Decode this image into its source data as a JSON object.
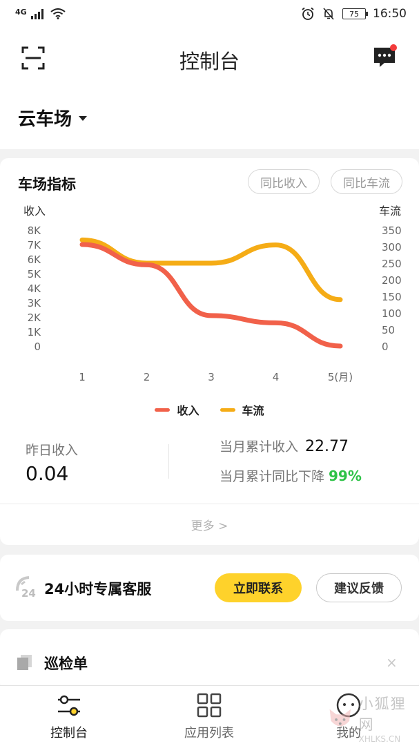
{
  "status_bar": {
    "network": "4G",
    "battery": "75",
    "time": "16:50"
  },
  "header": {
    "title": "控制台",
    "lot_name": "云车场"
  },
  "metrics": {
    "title": "车场指标",
    "btn_revenue_yoy": "同比收入",
    "btn_traffic_yoy": "同比车流",
    "yesterday_label": "昨日收入",
    "yesterday_value": "0.04",
    "month_label": "当月累计收入",
    "month_value": "22.77",
    "yoy_label": "当月累计同比下降",
    "yoy_value": "99%",
    "more": "更多 >"
  },
  "chart_data": {
    "type": "line",
    "x": [
      "1",
      "2",
      "3",
      "4",
      "5(月)"
    ],
    "left_axis": {
      "label": "收入",
      "ticks": [
        "0",
        "1K",
        "2K",
        "3K",
        "4K",
        "5K",
        "6K",
        "7K",
        "8K"
      ],
      "ylim": [
        0,
        8000
      ]
    },
    "right_axis": {
      "label": "车流",
      "ticks": [
        "0",
        "50",
        "100",
        "150",
        "200",
        "250",
        "300",
        "350"
      ],
      "ylim": [
        0,
        350
      ]
    },
    "series": [
      {
        "name": "收入",
        "axis": "left",
        "color": "#f1614a",
        "values": [
          7000,
          5600,
          2100,
          1600,
          0
        ]
      },
      {
        "name": "车流",
        "axis": "right",
        "color": "#f5ac16",
        "values": [
          320,
          250,
          250,
          305,
          140
        ]
      }
    ],
    "grid": false,
    "legend": "bottom-center"
  },
  "service": {
    "badge": "24",
    "title": "24小时专属客服",
    "contact_label": "立即联系",
    "feedback_label": "建议反馈"
  },
  "inspection": {
    "title": "巡检单",
    "close": "×"
  },
  "tabbar": {
    "items": [
      {
        "label": "控制台",
        "icon": "sliders-icon"
      },
      {
        "label": "应用列表",
        "icon": "grid-icon"
      },
      {
        "label": "我的",
        "icon": "smile-icon"
      }
    ]
  },
  "watermark": {
    "cn": "小狐狸网",
    "en": "XHLKS.CN"
  },
  "colors": {
    "accent": "#fed22b",
    "revenue": "#f1614a",
    "traffic": "#f5ac16",
    "positive": "#2ec247"
  }
}
